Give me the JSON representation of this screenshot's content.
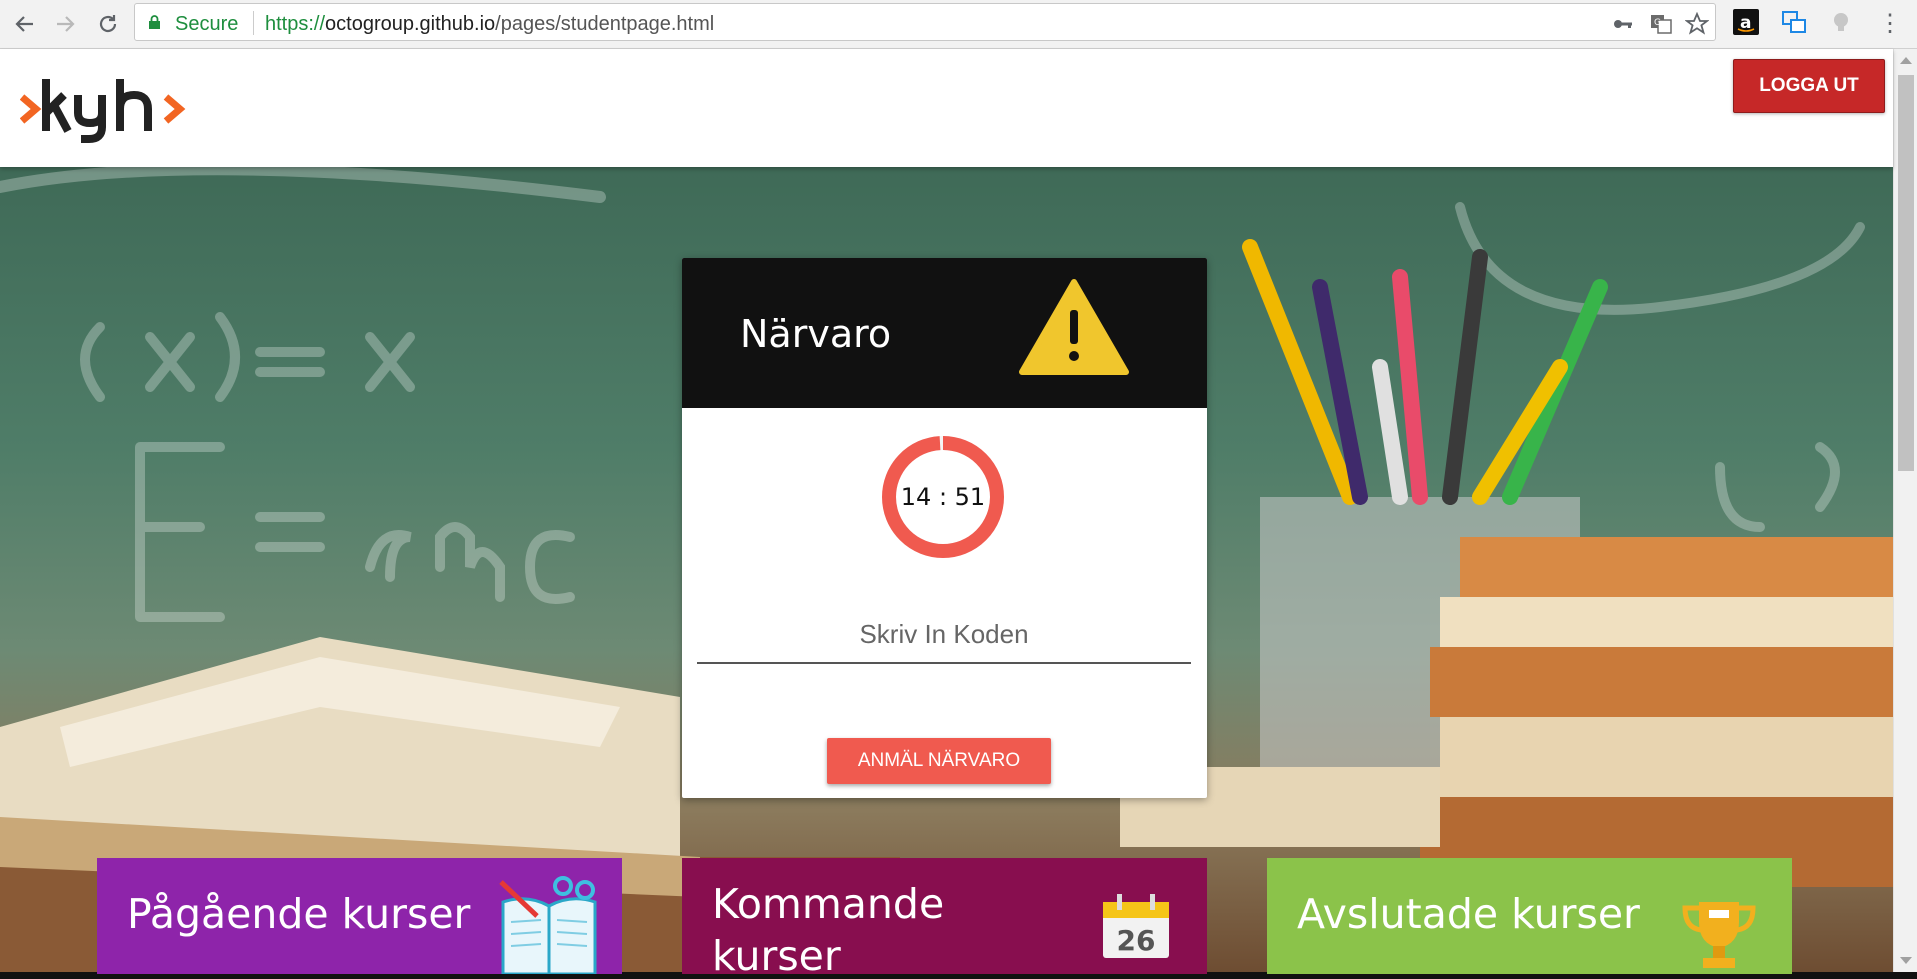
{
  "browser": {
    "secure_label": "Secure",
    "url_scheme": "https://",
    "url_host": "octogroup.github.io",
    "url_path": "/pages/studentpage.html",
    "icons": [
      "back-arrow-icon",
      "forward-arrow-icon",
      "reload-icon",
      "lock-icon",
      "key-icon",
      "translate-icon",
      "bookmark-star-icon",
      "amazon-extension-icon",
      "window-extension-icon",
      "bulb-extension-icon",
      "menu-dots-icon"
    ]
  },
  "header": {
    "logo_alt": ">kyh>",
    "logout_label": "LOGGA UT",
    "logout_color": "#c62828"
  },
  "attendance": {
    "title": "Närvaro",
    "timer": "14 : 51",
    "timer_progress": 0.99,
    "code_placeholder": "Skriv In Koden",
    "code_value": "",
    "submit_label": "ANMÄL NÄRVARO",
    "accent_color": "#f05a4f",
    "warning_color": "#f0c62d"
  },
  "tiles": [
    {
      "label": "Pågående kurser",
      "color": "#8e24aa",
      "icon": "open-book-icon"
    },
    {
      "label": "Kommande kurser",
      "color": "#880e4f",
      "icon": "calendar-icon",
      "icon_text": "26"
    },
    {
      "label": "Avslutade kurser",
      "color": "#8bc34a",
      "icon": "trophy-icon"
    }
  ]
}
